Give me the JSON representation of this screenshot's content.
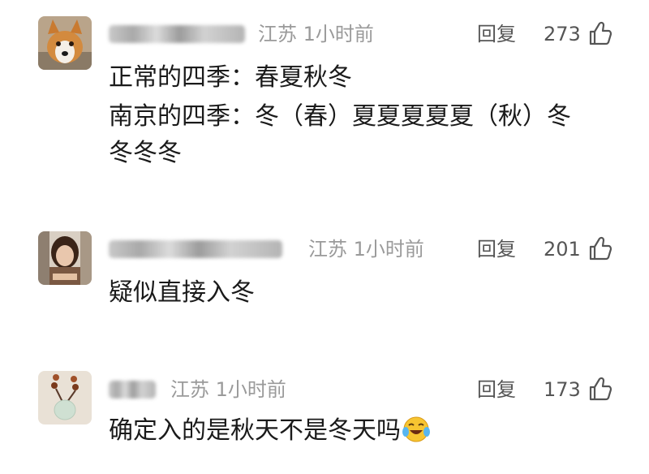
{
  "comments": [
    {
      "location_time": "江苏 1小时前",
      "reply_label": "回复",
      "likes": "273",
      "lines": [
        "正常的四季：春夏秋冬",
        "南京的四季：冬（春）夏夏夏夏夏（秋）冬",
        "冬冬冬"
      ],
      "avatar_icon": "dog-avatar"
    },
    {
      "location_time": "江苏 1小时前",
      "reply_label": "回复",
      "likes": "201",
      "lines": [
        "疑似直接入冬"
      ],
      "avatar_icon": "woman-avatar"
    },
    {
      "location_time": "江苏 1小时前",
      "reply_label": "回复",
      "likes": "173",
      "lines": [
        "确定入的是秋天不是冬天吗"
      ],
      "emoji": "laughing-crying-emoji",
      "avatar_icon": "jade-pendant-avatar"
    }
  ],
  "colors": {
    "meta_gray": "#9a9a9a",
    "action_gray": "#555555",
    "text": "#1a1a1a"
  }
}
